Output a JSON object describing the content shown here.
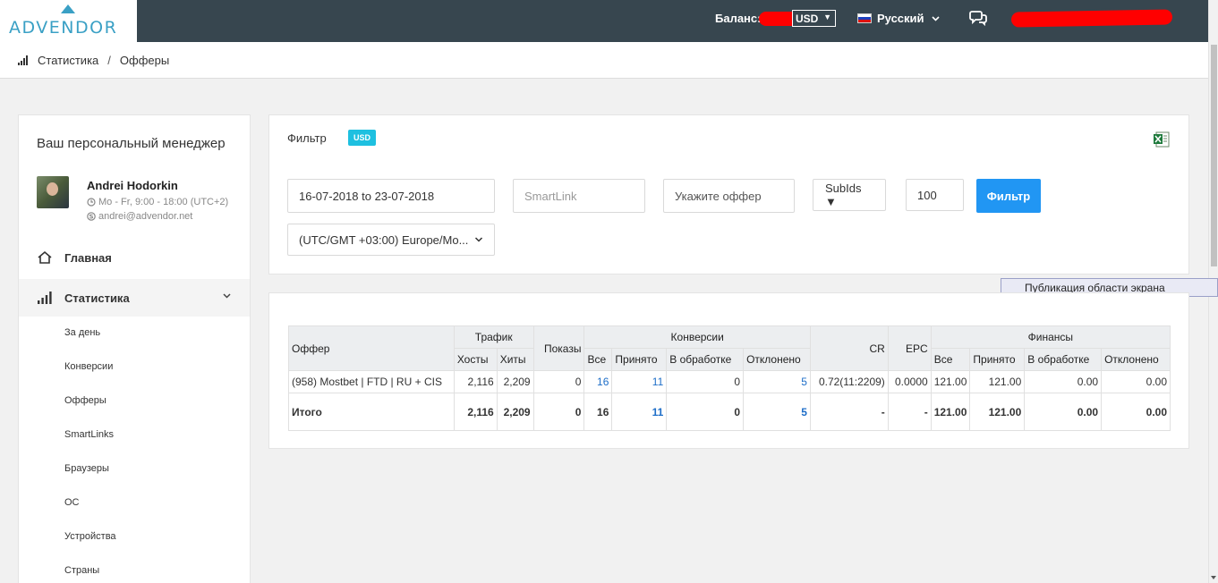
{
  "brand": {
    "name": "ADVENDOR"
  },
  "topbar": {
    "balance_label": "Баланс:",
    "currency": "USD",
    "language": "Русский"
  },
  "breadcrumb": {
    "items": [
      "Статистика",
      "Офферы"
    ],
    "separator": "/"
  },
  "sidebar": {
    "manager_title": "Ваш персональный менеджер",
    "manager": {
      "name": "Andrei Hodorkin",
      "hours": "Mo - Fr, 9:00 - 18:00 (UTC+2)",
      "email": "andrei@advendor.net"
    },
    "nav": [
      {
        "label": "Главная",
        "icon": "home-icon"
      },
      {
        "label": "Статистика",
        "icon": "bar-chart-icon",
        "active": true
      }
    ],
    "sub_items": [
      "За день",
      "Конверсии",
      "Офферы",
      "SmartLinks",
      "Браузеры",
      "ОС",
      "Устройства",
      "Страны"
    ]
  },
  "filter": {
    "title": "Фильтр",
    "currency_badge": "USD",
    "date_range": "16-07-2018 to 23-07-2018",
    "smartlink_placeholder": "SmartLink",
    "offer_placeholder": "Укажите оффер",
    "subids_label": "SubIds ▼",
    "limit": "100",
    "submit_label": "Фильтр",
    "timezone": "(UTC/GMT +03:00) Europe/Mo..."
  },
  "tooltip": "Публикация области экрана",
  "table": {
    "group_headers": {
      "offer": "Оффер",
      "traffic": "Трафик",
      "impressions": "Показы",
      "conversions": "Конверсии",
      "cr": "CR",
      "epc": "EPC",
      "finance": "Финансы"
    },
    "sub_headers": {
      "hosts": "Хосты",
      "hits": "Хиты",
      "conv_all": "Все",
      "conv_accepted": "Принято",
      "conv_pending": "В обработке",
      "conv_rejected": "Отклонено",
      "fin_all": "Все",
      "fin_accepted": "Принято",
      "fin_pending": "В обработке",
      "fin_rejected": "Отклонено"
    },
    "rows": [
      {
        "offer": "(958) Mostbet | FTD | RU + CIS",
        "hosts": "2,116",
        "hits": "2,209",
        "impressions": "0",
        "conv_all": "16",
        "conv_accepted": "11",
        "conv_pending": "0",
        "conv_rejected": "5",
        "cr": "0.72(11:2209)",
        "epc": "0.0000",
        "fin_all": "121.00",
        "fin_accepted": "121.00",
        "fin_pending": "0.00",
        "fin_rejected": "0.00"
      }
    ],
    "total": {
      "label": "Итого",
      "hosts": "2,116",
      "hits": "2,209",
      "impressions": "0",
      "conv_all": "16",
      "conv_accepted": "11",
      "conv_pending": "0",
      "conv_rejected": "5",
      "cr": "-",
      "epc": "-",
      "fin_all": "121.00",
      "fin_accepted": "121.00",
      "fin_pending": "0.00",
      "fin_rejected": "0.00"
    }
  },
  "colors": {
    "topbar": "#37464f",
    "accent": "#2196f3",
    "badge": "#1ec0e0",
    "link": "#1e6ec8"
  }
}
